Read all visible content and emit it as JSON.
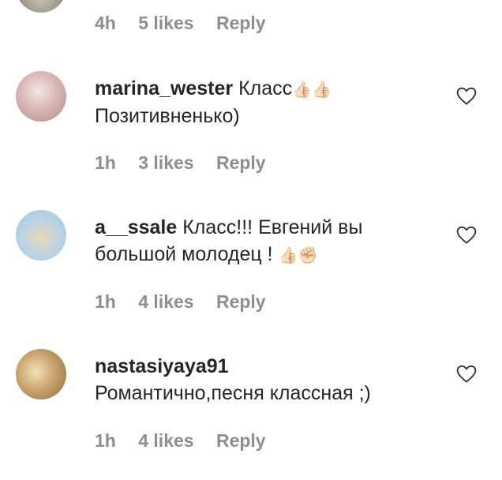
{
  "prev_comment": {
    "time": "4h",
    "likes": "5 likes",
    "reply": "Reply"
  },
  "comments": [
    {
      "username": "marina_wester",
      "text_line1": "Класс",
      "emoji": "👍🏻👍🏻",
      "text_line2": "Позитивненько)",
      "time": "1h",
      "likes": "3 likes",
      "reply": "Reply"
    },
    {
      "username": "a__ssale",
      "text_line1": "Класс!!! Евгений вы",
      "text_line2": "большой молодец ! ",
      "emoji": "👍🏻✊🏻",
      "time": "1h",
      "likes": "4 likes",
      "reply": "Reply"
    },
    {
      "username": "nastasiyaya91",
      "text_line1": "Романтично,песня классная ;)",
      "time": "1h",
      "likes": "4 likes",
      "reply": "Reply"
    }
  ],
  "icons": {
    "like": "heart-outline-icon"
  }
}
